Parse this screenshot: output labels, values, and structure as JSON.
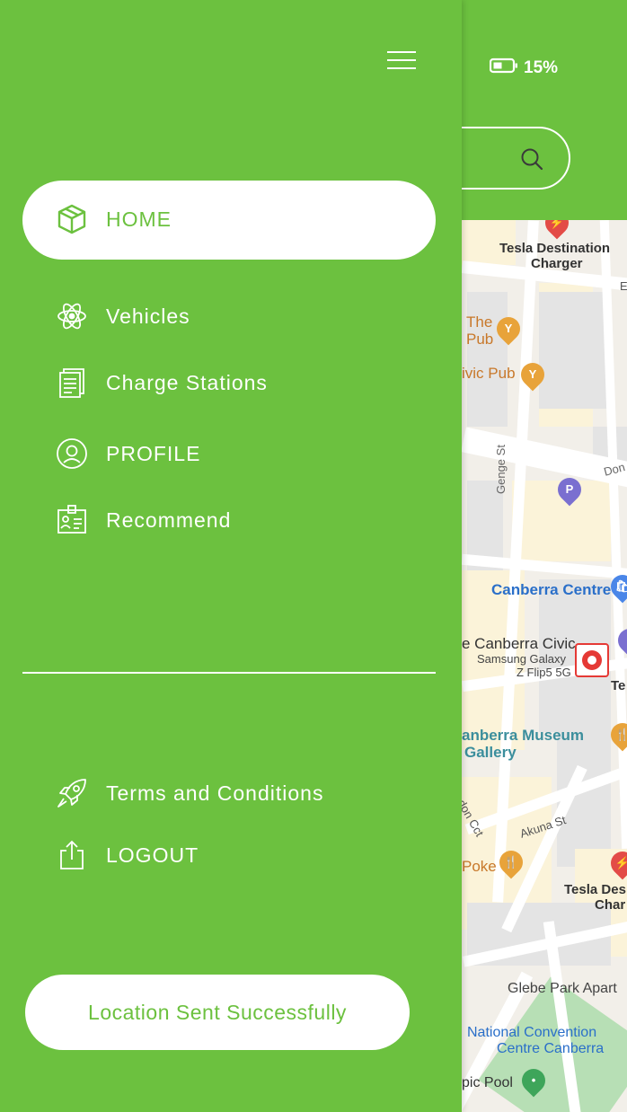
{
  "status": {
    "battery": "15%"
  },
  "menu": {
    "items": [
      {
        "label": "HOME",
        "icon": "box-icon"
      },
      {
        "label": "Vehicles",
        "icon": "atom-icon"
      },
      {
        "label": "Charge Stations",
        "icon": "document-icon"
      },
      {
        "label": "PROFILE",
        "icon": "user-circle-icon"
      },
      {
        "label": "Recommend",
        "icon": "id-card-icon"
      }
    ],
    "secondary": [
      {
        "label": "Terms and Conditions",
        "icon": "rocket-icon"
      },
      {
        "label": "LOGOUT",
        "icon": "share-upload-icon"
      }
    ]
  },
  "toast": "Location Sent Successfully",
  "map": {
    "labels": {
      "tesla_dest": "Tesla Destination",
      "charger": "Charger",
      "the": "The",
      "pub": "Pub",
      "civic_pub": "ivic Pub",
      "genge": "Genge St",
      "don": "Don",
      "canberra_centre": "Canberra Centre",
      "canberra_civic": "e Canberra Civic",
      "samsung1": "Samsung Galaxy",
      "samsung2": "Z Flip5 5G",
      "te": "Te",
      "museum1": "anberra Museum",
      "museum2": "Gallery",
      "london": "ondon Cct",
      "akuna": "Akuna St",
      "poke": "Poke",
      "tesla_des2": "Tesla Des",
      "char2": "Char",
      "glebe": "Glebe Park Apart",
      "national1": "National Convention",
      "national2": "Centre Canberra",
      "pool": "pic Pool",
      "e": "E"
    }
  },
  "colors": {
    "brand": "#6cc13f",
    "white": "#ffffff"
  }
}
